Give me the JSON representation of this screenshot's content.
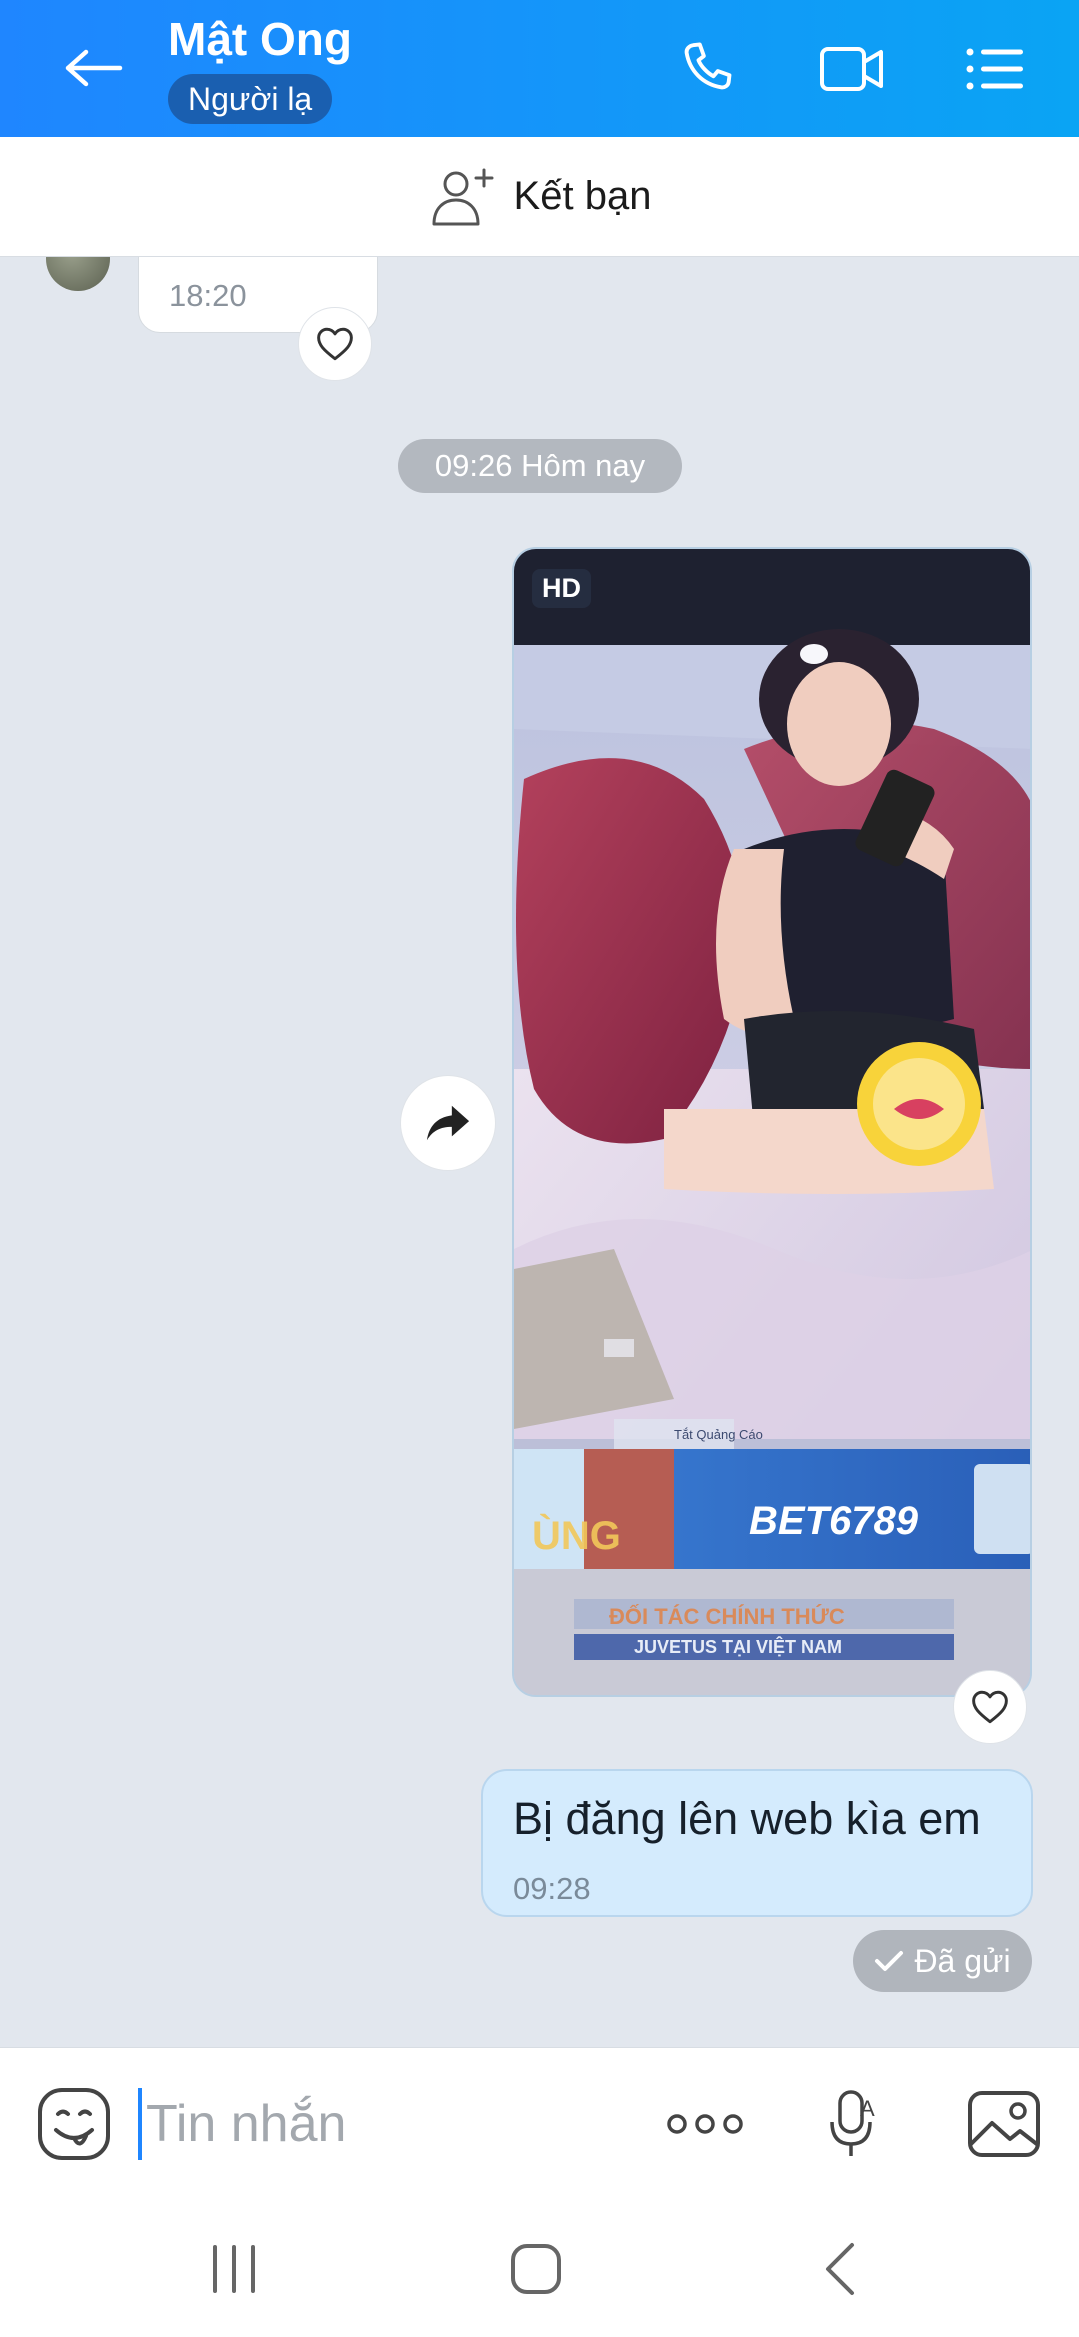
{
  "header": {
    "title": "Mật Ong",
    "badge": "Người lạ",
    "icons": [
      "back-arrow-icon",
      "phone-icon",
      "video-call-icon",
      "list-menu-icon"
    ]
  },
  "friend_bar": {
    "label": "Kết bạn",
    "icon": "add-friend-icon"
  },
  "chat": {
    "incoming_message": {
      "time": "18:20"
    },
    "date_separator": "09:26 Hôm nay",
    "photo_message": {
      "tag": "HD",
      "caption_text_in_image": [
        "Tắt Quảng Cáo",
        "BET6789",
        "ĐỐI TÁC CHÍNH THỨC",
        "JUVETUS TẠI VIỆT NAM"
      ]
    },
    "outgoing_message": {
      "text": "Bị đăng lên web kìa em",
      "time": "09:28"
    },
    "status": "Đã gửi"
  },
  "composer": {
    "placeholder": "Tin nhắn",
    "icons": [
      "sticker-icon",
      "more-dots-icon",
      "voice-to-text-icon",
      "gallery-icon"
    ]
  },
  "system_nav": {
    "icons": [
      "recent-apps-icon",
      "home-icon",
      "back-icon"
    ]
  },
  "colors": {
    "header_start": "#1f86ff",
    "header_end": "#0aa4f4",
    "chat_bg": "#e2e7ee",
    "outgoing_bubble": "#d4ebfd"
  }
}
